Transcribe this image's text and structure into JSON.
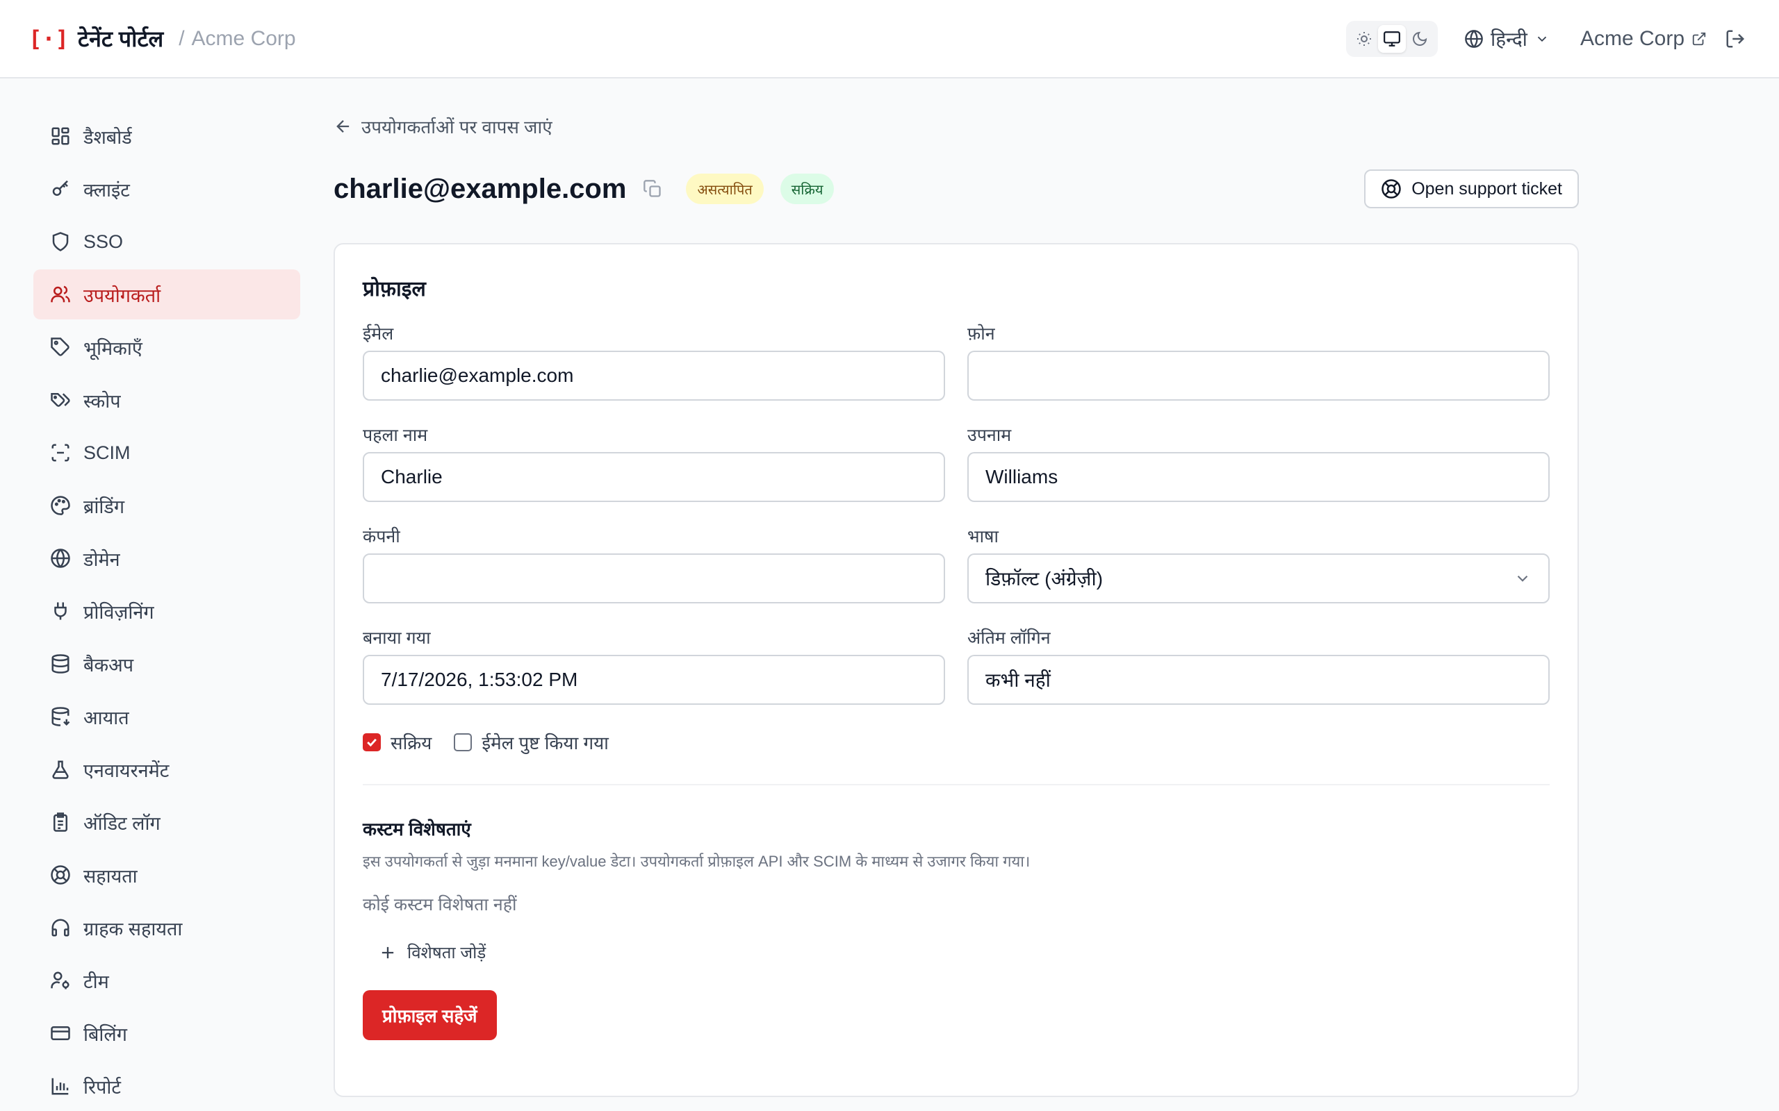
{
  "header": {
    "logo_glyph": "[·]",
    "title": "टेनेंट पोर्टल",
    "separator": "/",
    "tenant": "Acme Corp",
    "language": "हिन्दी",
    "tenant_link": "Acme Corp"
  },
  "sidebar": {
    "items": [
      {
        "label": "डैशबोर्ड",
        "icon": "dashboard-icon"
      },
      {
        "label": "क्लाइंट",
        "icon": "key-icon"
      },
      {
        "label": "SSO",
        "icon": "shield-icon"
      },
      {
        "label": "उपयोगकर्ता",
        "icon": "users-icon",
        "active": true
      },
      {
        "label": "भूमिकाएँ",
        "icon": "tag-icon"
      },
      {
        "label": "स्कोप",
        "icon": "tags-icon"
      },
      {
        "label": "SCIM",
        "icon": "scan-icon"
      },
      {
        "label": "ब्रांडिंग",
        "icon": "palette-icon"
      },
      {
        "label": "डोमेन",
        "icon": "globe-icon"
      },
      {
        "label": "प्रोविज़निंग",
        "icon": "plug-icon"
      },
      {
        "label": "बैकअप",
        "icon": "database-icon"
      },
      {
        "label": "आयात",
        "icon": "database-import-icon"
      },
      {
        "label": "एनवायरनमेंट",
        "icon": "flask-icon"
      },
      {
        "label": "ऑडिट लॉग",
        "icon": "clipboard-icon"
      },
      {
        "label": "सहायता",
        "icon": "lifebuoy-icon"
      },
      {
        "label": "ग्राहक सहायता",
        "icon": "headset-icon"
      },
      {
        "label": "टीम",
        "icon": "user-cog-icon"
      },
      {
        "label": "बिलिंग",
        "icon": "credit-card-icon"
      },
      {
        "label": "रिपोर्ट",
        "icon": "bar-chart-icon"
      }
    ]
  },
  "main": {
    "back_label": "उपयोगकर्ताओं पर वापस जाएं",
    "title": "charlie@example.com",
    "badge_unverified": "असत्यापित",
    "badge_active": "सक्रिय",
    "support_button": "Open support ticket",
    "profile": {
      "title": "प्रोफ़ाइल",
      "email_label": "ईमेल",
      "email_value": "charlie@example.com",
      "phone_label": "फ़ोन",
      "phone_value": "",
      "first_name_label": "पहला नाम",
      "first_name_value": "Charlie",
      "last_name_label": "उपनाम",
      "last_name_value": "Williams",
      "company_label": "कंपनी",
      "company_value": "",
      "language_label": "भाषा",
      "language_value": "डिफ़ॉल्ट (अंग्रेज़ी)",
      "created_label": "बनाया गया",
      "created_value": "7/17/2026, 1:53:02 PM",
      "last_login_label": "अंतिम लॉगिन",
      "last_login_value": "कभी नहीं",
      "active_label": "सक्रिय",
      "active_checked": true,
      "email_verified_label": "ईमेल पुष्ट किया गया",
      "email_verified_checked": false
    },
    "custom": {
      "title": "कस्टम विशेषताएं",
      "description": "इस उपयोगकर्ता से जुड़ा मनमाना key/value डेटा। उपयोगकर्ता प्रोफ़ाइल API और SCIM के माध्यम से उजागर किया गया।",
      "empty": "कोई कस्टम विशेषता नहीं",
      "add_label": "विशेषता जोड़ें"
    },
    "save_button": "प्रोफ़ाइल सहेजें"
  },
  "colors": {
    "accent": "#dc2626",
    "active_nav_bg": "#fbe7e7",
    "badge_yellow_bg": "#fef9c3",
    "badge_green_bg": "#dcfce7"
  }
}
